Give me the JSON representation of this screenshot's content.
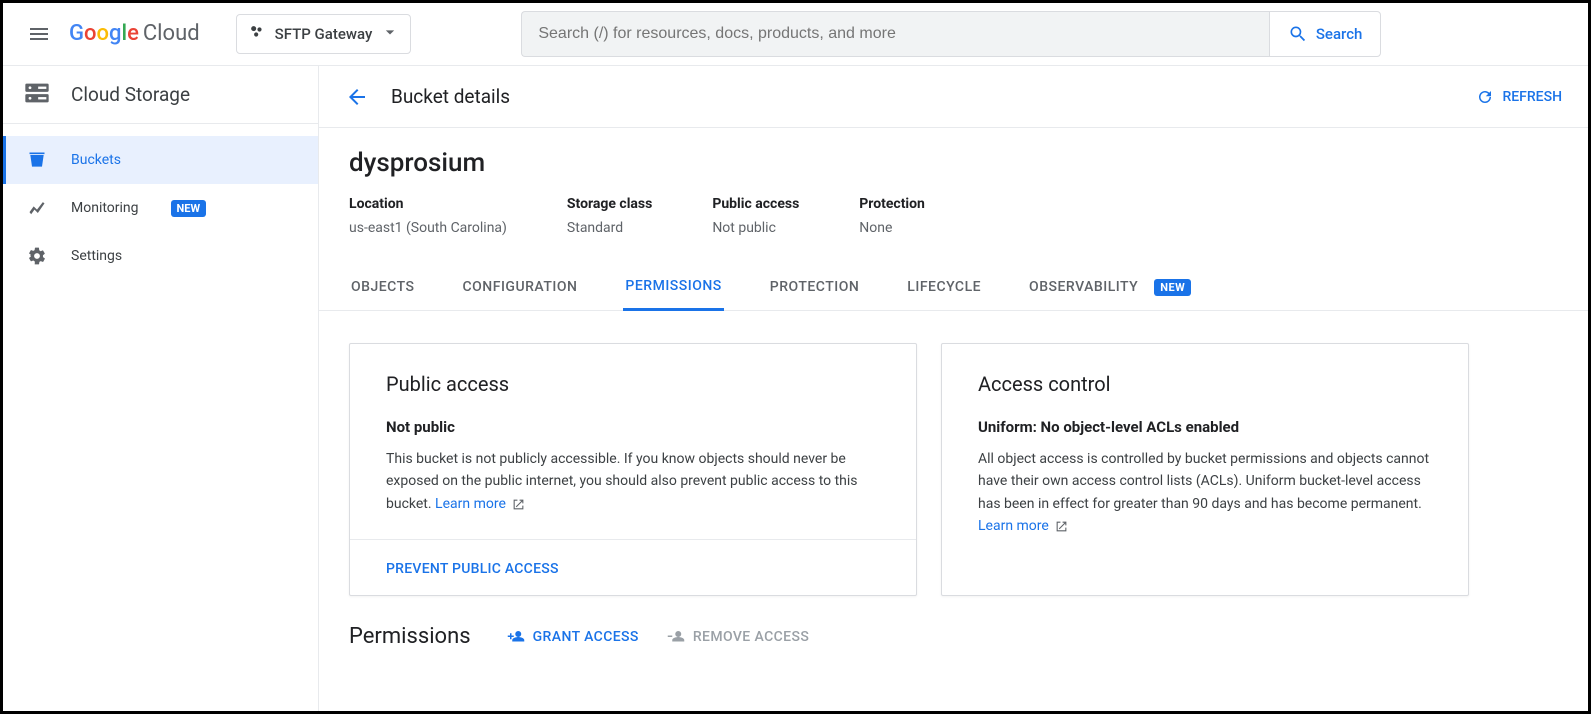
{
  "header": {
    "logo_brand": "Google",
    "logo_product": "Cloud",
    "project_name": "SFTP Gateway",
    "search_placeholder": "Search (/) for resources, docs, products, and more",
    "search_button": "Search"
  },
  "sidebar": {
    "service_title": "Cloud Storage",
    "items": [
      {
        "label": "Buckets",
        "icon": "bucket"
      },
      {
        "label": "Monitoring",
        "icon": "chart",
        "badge": "NEW"
      },
      {
        "label": "Settings",
        "icon": "gear"
      }
    ]
  },
  "page": {
    "title": "Bucket details",
    "refresh_label": "REFRESH",
    "bucket_name": "dysprosium",
    "meta": [
      {
        "label": "Location",
        "value": "us-east1 (South Carolina)"
      },
      {
        "label": "Storage class",
        "value": "Standard"
      },
      {
        "label": "Public access",
        "value": "Not public"
      },
      {
        "label": "Protection",
        "value": "None"
      }
    ],
    "tabs": [
      {
        "label": "OBJECTS"
      },
      {
        "label": "CONFIGURATION"
      },
      {
        "label": "PERMISSIONS",
        "active": true
      },
      {
        "label": "PROTECTION"
      },
      {
        "label": "LIFECYCLE"
      },
      {
        "label": "OBSERVABILITY",
        "badge": "NEW"
      }
    ],
    "public_access_card": {
      "title": "Public access",
      "subtitle": "Not public",
      "text": "This bucket is not publicly accessible. If you know objects should never be exposed on the public internet, you should also prevent public access to this bucket. ",
      "learn_more": "Learn more",
      "action": "PREVENT PUBLIC ACCESS"
    },
    "access_control_card": {
      "title": "Access control",
      "subtitle": "Uniform: No object-level ACLs enabled",
      "text": "All object access is controlled by bucket permissions and objects cannot have their own access control lists (ACLs). Uniform bucket-level access has been in effect for greater than 90 days and has become permanent. ",
      "learn_more": "Learn more"
    },
    "permissions_section": {
      "title": "Permissions",
      "grant_label": "GRANT ACCESS",
      "remove_label": "REMOVE ACCESS"
    }
  }
}
